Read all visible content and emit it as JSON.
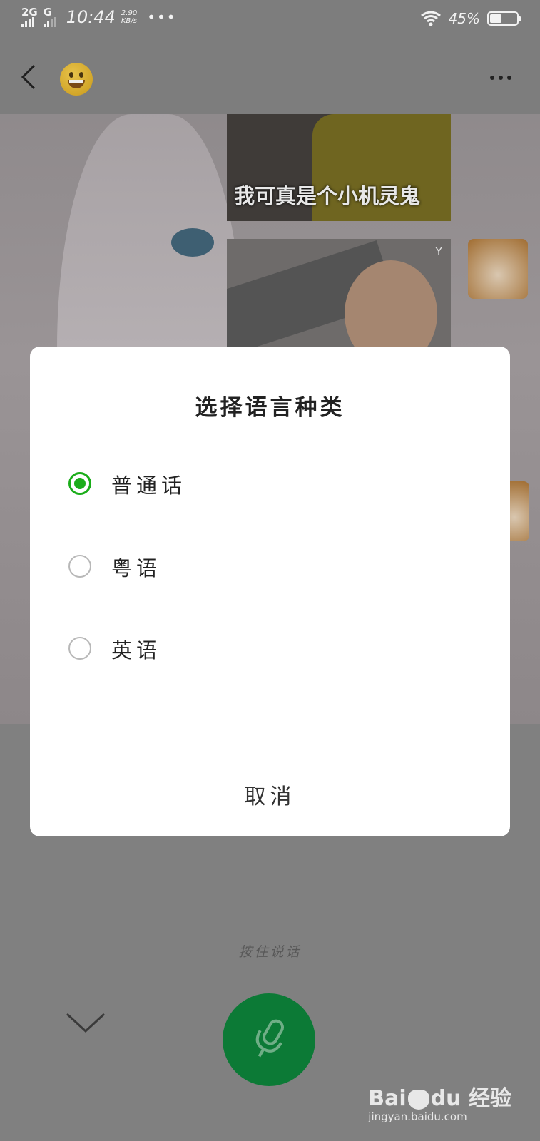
{
  "status_bar": {
    "network_1": "2G",
    "network_2": "G",
    "time": "10:44",
    "speed_value": "2.90",
    "speed_unit": "KB/s",
    "more": "•••",
    "battery_percent": "45%",
    "battery_level": 0.45
  },
  "header": {
    "back_icon": "chevron-left-icon",
    "contact_avatar": "grinning-face-emoji",
    "more_icon": "ellipsis-icon"
  },
  "chat": {
    "image_caption": "我可真是个小机灵鬼",
    "image_tag": "Y"
  },
  "dialog": {
    "title": "选择语言种类",
    "options": [
      {
        "label": "普通话",
        "selected": true
      },
      {
        "label": "粤语",
        "selected": false
      },
      {
        "label": "英语",
        "selected": false
      }
    ],
    "cancel_label": "取消"
  },
  "bottom": {
    "hold_to_talk": "按住说话",
    "collapse_icon": "chevron-down-icon",
    "mic_icon": "microphone-icon"
  },
  "watermark": {
    "brand_left": "Bai",
    "brand_right": "du",
    "suffix": "经验",
    "url": "jingyan.baidu.com"
  },
  "colors": {
    "accent_green": "#1aad19",
    "mic_button": "#0c7a36",
    "overlay": "#808080"
  }
}
